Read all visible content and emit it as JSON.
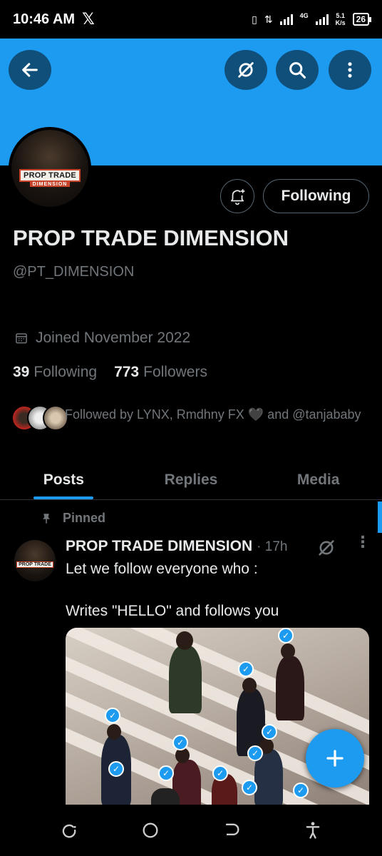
{
  "status_bar": {
    "time": "10:46 AM",
    "app_logo": "𝕏",
    "network_type": "4G",
    "speed_value": "5.1",
    "speed_unit": "K/s",
    "battery": "26"
  },
  "header": {
    "back_icon": "arrow-left-icon",
    "grok_icon": "grok-icon",
    "search_icon": "search-icon",
    "more_icon": "more-vertical-icon",
    "banner_color": "#1d9bf0"
  },
  "profile": {
    "avatar_text_top": "PROP TRADE",
    "avatar_text_bottom": "DIMENSION",
    "name": "PROP TRADE DIMENSION",
    "handle": "@PT_DIMENSION",
    "joined": "Joined November 2022",
    "following_count": "39",
    "following_label": "Following",
    "followers_count": "773",
    "followers_label": "Followers",
    "followed_by": "Followed by LYNX, Rmdhny FX 🖤 and @tanjababy",
    "follow_button": "Following"
  },
  "tabs": [
    {
      "label": "Posts",
      "active": true
    },
    {
      "label": "Replies",
      "active": false
    },
    {
      "label": "Media",
      "active": false
    }
  ],
  "pinned_tweet": {
    "pinned_label": "Pinned",
    "author": "PROP TRADE DIMENSION",
    "time": "· 17h",
    "text_line1": "Let we follow everyone who :",
    "text_line2": "Writes \"HELLO\" and follows you",
    "more": "⋮"
  },
  "colors": {
    "accent": "#1d9bf0",
    "muted": "#71767b",
    "text": "#e7e9ea",
    "background": "#000000"
  }
}
